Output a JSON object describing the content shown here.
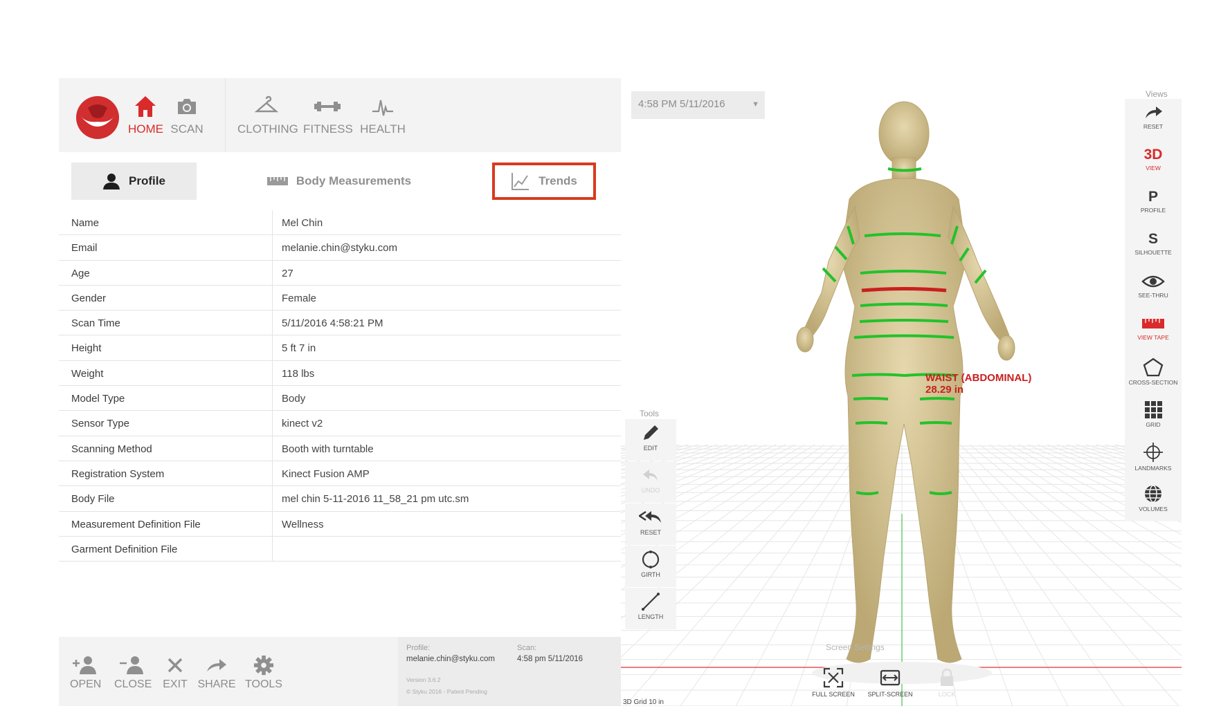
{
  "nav": {
    "items": [
      {
        "label": "HOME",
        "icon": "home-icon",
        "active": true
      },
      {
        "label": "SCAN",
        "icon": "camera-icon",
        "active": false
      },
      {
        "label": "CLOTHING",
        "icon": "hanger-icon",
        "active": false
      },
      {
        "label": "FITNESS",
        "icon": "dumbbell-icon",
        "active": false
      },
      {
        "label": "HEALTH",
        "icon": "heartbeat-icon",
        "active": false
      }
    ]
  },
  "tabs": [
    {
      "label": "Profile",
      "icon": "user-icon",
      "selected": true
    },
    {
      "label": "Body Measurements",
      "icon": "ruler-icon",
      "selected": false
    },
    {
      "label": "Trends",
      "icon": "chart-icon",
      "highlighted": true
    }
  ],
  "profile": {
    "rows": [
      {
        "key": "Name",
        "value": "Mel Chin"
      },
      {
        "key": "Email",
        "value": "melanie.chin@styku.com"
      },
      {
        "key": "Age",
        "value": "27"
      },
      {
        "key": "Gender",
        "value": "Female"
      },
      {
        "key": "Scan Time",
        "value": "5/11/2016 4:58:21 PM"
      },
      {
        "key": "Height",
        "value": "5 ft 7 in"
      },
      {
        "key": "Weight",
        "value": "118 lbs"
      },
      {
        "key": "Model Type",
        "value": "Body"
      },
      {
        "key": "Sensor Type",
        "value": "kinect v2"
      },
      {
        "key": "Scanning Method",
        "value": "Booth with turntable"
      },
      {
        "key": "Registration System",
        "value": "Kinect Fusion AMP"
      },
      {
        "key": "Body File",
        "value": "mel chin 5-11-2016 11_58_21 pm utc.sm"
      },
      {
        "key": "Measurement Definition File",
        "value": "Wellness"
      },
      {
        "key": "Garment Definition File",
        "value": ""
      }
    ]
  },
  "bottom": {
    "buttons": [
      {
        "label": "OPEN",
        "icon": "add-user-icon"
      },
      {
        "label": "CLOSE",
        "icon": "remove-user-icon"
      },
      {
        "label": "EXIT",
        "icon": "close-icon"
      },
      {
        "label": "SHARE",
        "icon": "share-arrow-icon"
      },
      {
        "label": "TOOLS",
        "icon": "gear-icon"
      }
    ],
    "info": {
      "profile_label": "Profile:",
      "profile_value": "melanie.chin@styku.com",
      "scan_label": "Scan:",
      "scan_value": "4:58 pm 5/11/2016",
      "version": "Version 3.6.2",
      "copyright": "© Styku 2016 - Patent Pending"
    }
  },
  "viewer": {
    "date_select": "4:58 PM 5/11/2016",
    "tools_label": "Tools",
    "tools": [
      {
        "label": "EDIT",
        "icon": "pencil-icon",
        "enabled": true
      },
      {
        "label": "UNDO",
        "icon": "undo-icon",
        "enabled": false
      },
      {
        "label": "RESET",
        "icon": "reset-icon",
        "enabled": true
      },
      {
        "label": "GIRTH",
        "icon": "girth-icon",
        "enabled": true
      },
      {
        "label": "LENGTH",
        "icon": "length-icon",
        "enabled": true
      }
    ],
    "views_label": "Views",
    "views": [
      {
        "label": "RESET",
        "glyph": "",
        "icon": "reset-arrow-icon",
        "active": false
      },
      {
        "label": "VIEW",
        "glyph": "3D",
        "icon": "",
        "active": true
      },
      {
        "label": "PROFILE",
        "glyph": "P",
        "icon": "",
        "active": false
      },
      {
        "label": "SILHOUETTE",
        "glyph": "S",
        "icon": "",
        "active": false
      },
      {
        "label": "SEE-THRU",
        "glyph": "",
        "icon": "eye-icon",
        "active": false
      },
      {
        "label": "VIEW TAPE",
        "glyph": "",
        "icon": "tape-icon",
        "active": true
      },
      {
        "label": "CROSS-SECTION",
        "glyph": "",
        "icon": "pentagon-icon",
        "active": false
      },
      {
        "label": "GRID",
        "glyph": "",
        "icon": "grid-icon",
        "active": false
      },
      {
        "label": "LANDMARKS",
        "glyph": "",
        "icon": "crosshair-icon",
        "active": false
      },
      {
        "label": "VOLUMES",
        "glyph": "",
        "icon": "globe-icon",
        "active": false
      }
    ],
    "measurement": {
      "name": "WAIST (ABDOMINAL)",
      "value": "28.29 in"
    },
    "screen_settings": {
      "label": "Screen Settings",
      "buttons": [
        {
          "label": "FULL SCREEN",
          "icon": "fullscreen-icon",
          "enabled": true
        },
        {
          "label": "SPLIT-SCREEN",
          "icon": "split-screen-icon",
          "enabled": true
        },
        {
          "label": "LOCK",
          "icon": "lock-icon",
          "enabled": false
        }
      ]
    },
    "grid_label": "3D Grid 10 in"
  },
  "colors": {
    "accent": "#d92b2b",
    "tape": "#22c22a",
    "tape_active": "#c8201f",
    "body": "#d9c89a",
    "highlight_box": "#d93a1e"
  }
}
